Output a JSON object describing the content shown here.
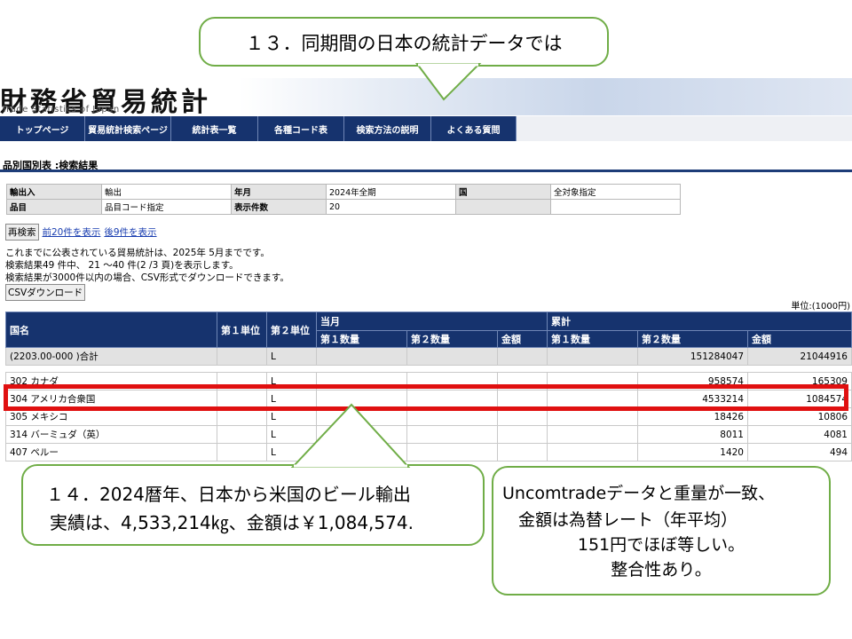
{
  "callouts": {
    "step13": "１３．同期間の日本の統計データでは",
    "step14_line1": "１４．2024暦年、日本から米国のビール輸出",
    "step14_line2": "実績は、4,533,214㎏、金額は￥1,084,574.",
    "note_line1": "Uncomtradeデータと重量が一致、",
    "note_line2": "金額は為替レート（年平均）",
    "note_line3": "151円でほぼ等しい。",
    "note_line4": "整合性あり。"
  },
  "header": {
    "title": "財務省貿易統計",
    "subtitle": "Trade Statistics of Japan"
  },
  "nav": {
    "items": [
      {
        "label": "トップページ"
      },
      {
        "label": "貿易統計検索ページ"
      },
      {
        "label": "統計表一覧"
      },
      {
        "label": "各種コード表"
      },
      {
        "label": "検索方法の説明"
      },
      {
        "label": "よくある質問"
      }
    ]
  },
  "results_heading": "品別国別表 :検索結果",
  "conditions": {
    "row1": {
      "l1": "輸出入",
      "v1": "輸出",
      "l2": "年月",
      "v2": "2024年全期",
      "l3": "国",
      "v3": "全対象指定"
    },
    "row2": {
      "l1": "品目",
      "v1": "品目コード指定",
      "l2": "表示件数",
      "v2": "20",
      "l3": "",
      "v3": ""
    }
  },
  "controls": {
    "research_button": "再検索",
    "prev_link": "前20件を表示",
    "next_link": "後9件を表示",
    "csv_button": "CSVダウンロード"
  },
  "info": {
    "line1": "これまでに公表されている貿易統計は、2025年 5月までです。",
    "line2": "検索結果49 件中、 21 〜40 件(2 /3 頁)を表示します。",
    "line3": "検索結果が3000件以内の場合、CSV形式でダウンロードできます。"
  },
  "unit_label": "単位:(1000円)",
  "table": {
    "headers": {
      "country": "国名",
      "unit1": "第１単位",
      "unit2": "第２単位",
      "current": "当月",
      "cumulative": "累計",
      "qty1": "第１数量",
      "qty2": "第２数量",
      "amount": "金額"
    },
    "total": {
      "name": "(2203.00-000 )合計",
      "unit1": "",
      "unit2": "L",
      "m_q1": "",
      "m_q2": "",
      "m_amt": "",
      "c_q1": "",
      "c_q2": "151284047",
      "c_amt": "21044916"
    },
    "rows": [
      {
        "name": "302 カナダ",
        "unit1": "",
        "unit2": "L",
        "m_q1": "",
        "m_q2": "",
        "m_amt": "",
        "c_q1": "",
        "c_q2": "958574",
        "c_amt": "165309"
      },
      {
        "name": "304 アメリカ合衆国",
        "unit1": "",
        "unit2": "L",
        "m_q1": "",
        "m_q2": "",
        "m_amt": "",
        "c_q1": "",
        "c_q2": "4533214",
        "c_amt": "1084574"
      },
      {
        "name": "305 メキシコ",
        "unit1": "",
        "unit2": "L",
        "m_q1": "",
        "m_q2": "",
        "m_amt": "",
        "c_q1": "",
        "c_q2": "18426",
        "c_amt": "10806"
      },
      {
        "name": "314 バーミュダ（英）",
        "unit1": "",
        "unit2": "L",
        "m_q1": "",
        "m_q2": "",
        "m_amt": "",
        "c_q1": "",
        "c_q2": "8011",
        "c_amt": "4081"
      },
      {
        "name": "407 ペルー",
        "unit1": "",
        "unit2": "L",
        "m_q1": "",
        "m_q2": "",
        "m_amt": "",
        "c_q1": "",
        "c_q2": "1420",
        "c_amt": "494"
      }
    ]
  },
  "colors": {
    "nav_bg": "#16336e",
    "callout_border": "#70ad47",
    "highlight": "#e01010"
  }
}
